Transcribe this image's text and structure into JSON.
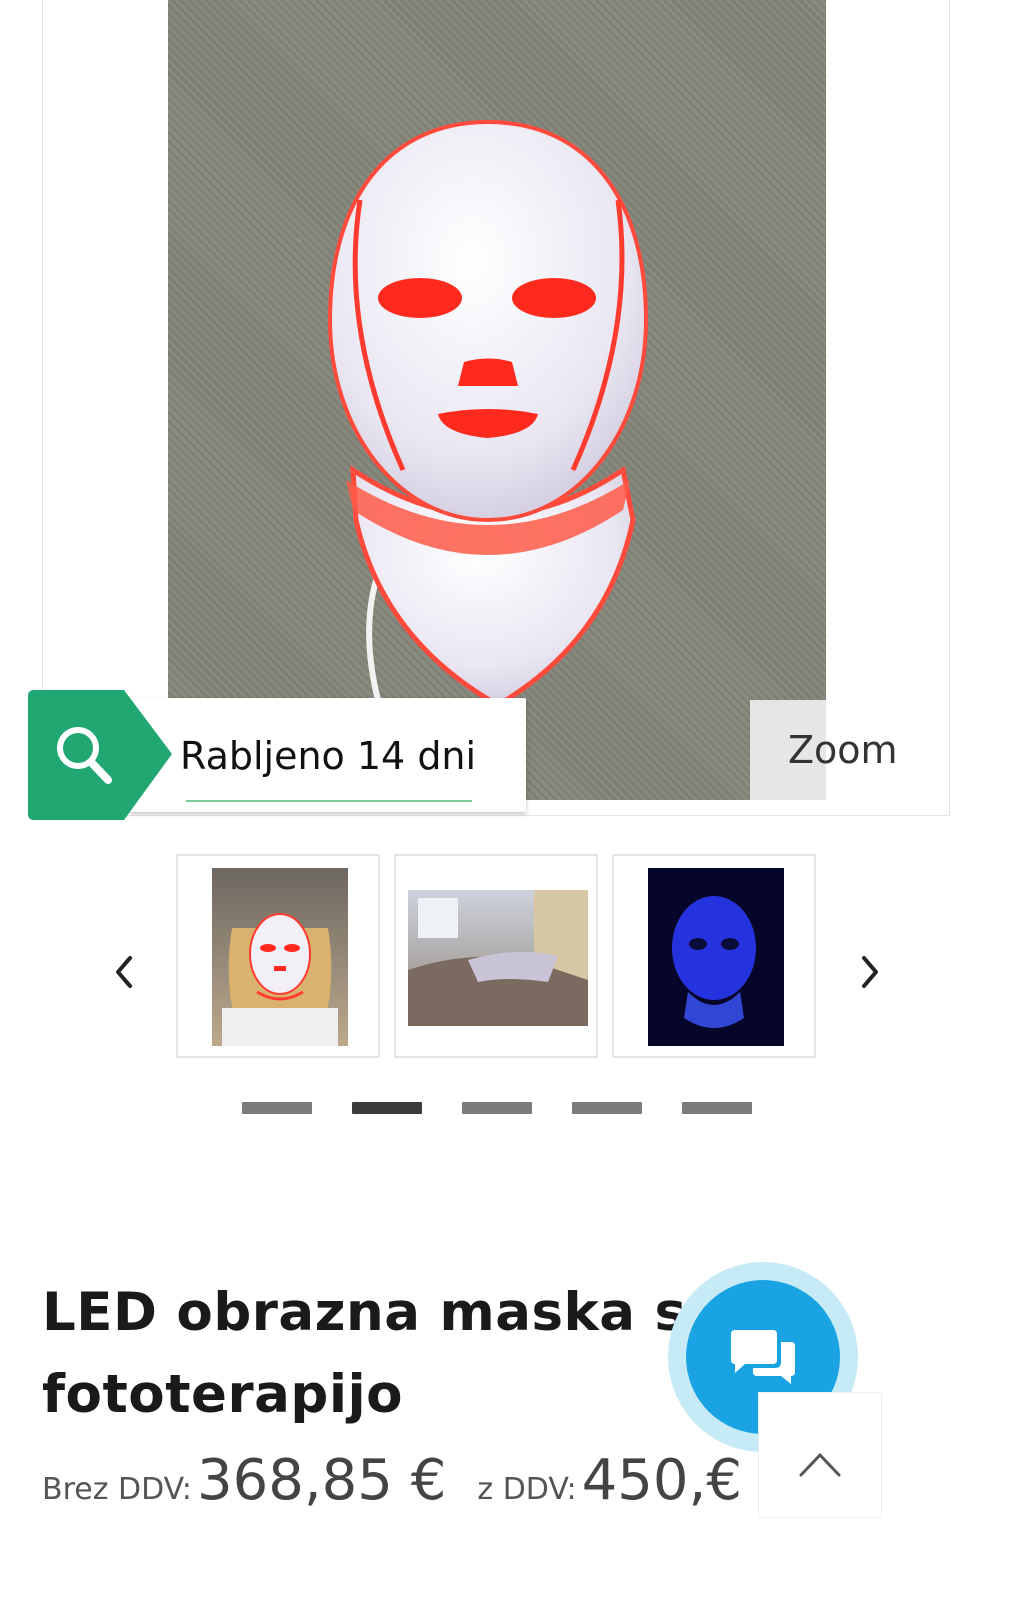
{
  "gallery": {
    "badge_text": "Rabljeno 14 dni",
    "zoom_label": "Zoom",
    "prev_icon": "chevron-left-icon",
    "next_icon": "chevron-right-icon",
    "search_icon": "magnifier-icon",
    "slide_count": 5,
    "active_slide": 2
  },
  "product": {
    "title": "LED obrazna maska s fototerapijo",
    "price_net_label": "Brez DDV:",
    "price_net": "368,85 €",
    "price_gross_label": "z DDV:",
    "price_gross": "450,€"
  },
  "colors": {
    "badge_green": "#21a872",
    "chat_blue": "#1aa3e3",
    "chat_halo": "#c7eaf7"
  },
  "floating": {
    "chat_icon": "chat-bubbles-icon",
    "back_to_top_icon": "chevron-up-icon"
  }
}
